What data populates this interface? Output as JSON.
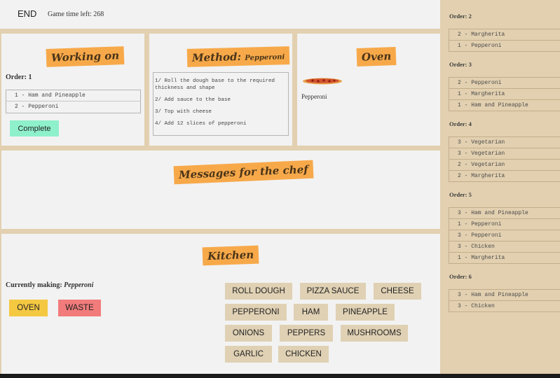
{
  "topbar": {
    "end_label": "END",
    "time_label": "Game time left:",
    "time_value": "268"
  },
  "working_on": {
    "title": "Working on",
    "order_label": "Order: 1",
    "items": [
      "1 - Ham and Pineapple",
      "2 - Pepperoni"
    ],
    "complete_label": "Complete"
  },
  "method": {
    "title": "Method:",
    "pizza": "Pepperoni",
    "steps": [
      "1/ Roll the dough base to the required thickness and shape",
      "2/ Add sauce to the base",
      "3/ Top with cheese",
      "4/ Add 12 slices of pepperoni"
    ]
  },
  "oven": {
    "title": "Oven",
    "pizza_name": "Pepperoni",
    "pizza_icon": "pizza-icon"
  },
  "messages": {
    "title": "Messages for the chef"
  },
  "kitchen": {
    "title": "Kitchen",
    "making_label": "Currently making:",
    "making_value": "Pepperoni",
    "oven_label": "OVEN",
    "waste_label": "WASTE",
    "ingredients": [
      "ROLL DOUGH",
      "PIZZA SAUCE",
      "CHEESE",
      "PEPPERONI",
      "HAM",
      "PINEAPPLE",
      "ONIONS",
      "PEPPERS",
      "MUSHROOMS",
      "GARLIC",
      "CHICKEN"
    ]
  },
  "sidebar": {
    "orders": [
      {
        "label": "Order: 2",
        "items": [
          "2 - Margherita",
          "1 - Pepperoni"
        ]
      },
      {
        "label": "Order: 3",
        "items": [
          "2 - Pepperoni",
          "1 - Margherita",
          "1 - Ham and Pineapple"
        ]
      },
      {
        "label": "Order: 4",
        "items": [
          "3 - Vegetarian",
          "3 - Vegetarian",
          "2 - Vegetarian",
          "2 - Margherita"
        ]
      },
      {
        "label": "Order: 5",
        "items": [
          "3 - Ham and Pineapple",
          "1 - Pepperoni",
          "3 - Pepperoni",
          "3 - Chicken",
          "1 - Margherita"
        ]
      },
      {
        "label": "Order: 6",
        "items": [
          "3 - Ham and Pineapple",
          "3 - Chicken"
        ]
      }
    ]
  },
  "colors": {
    "sticky": "#f7a94a",
    "complete": "#8ff0cc",
    "oven": "#f5c842",
    "waste": "#f27b7b",
    "ingredient": "#e0d1b4",
    "background": "#e2d0b0"
  }
}
